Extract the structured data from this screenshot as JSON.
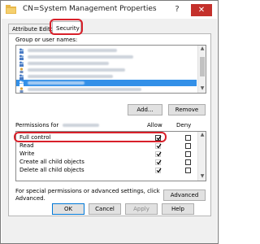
{
  "window": {
    "title": "CN=System Management Properties",
    "help_symbol": "?",
    "close_symbol": "✕"
  },
  "tabs": [
    {
      "label": "Attribute Editor",
      "active": false
    },
    {
      "label": "Security",
      "active": true
    }
  ],
  "security": {
    "group_label": "Group or user names:",
    "add_label": "Add...",
    "remove_label": "Remove",
    "permissions_label": "Permissions for",
    "allow_label": "Allow",
    "deny_label": "Deny",
    "permissions": [
      {
        "name": "Full control",
        "allow": true,
        "deny": false
      },
      {
        "name": "Read",
        "allow": true,
        "deny": false
      },
      {
        "name": "Write",
        "allow": true,
        "deny": false
      },
      {
        "name": "Create all child objects",
        "allow": true,
        "deny": false
      },
      {
        "name": "Delete all child objects",
        "allow": true,
        "deny": false
      }
    ],
    "special_text_1": "For special permissions or advanced settings, click",
    "special_text_2": "Advanced.",
    "advanced_label": "Advanced"
  },
  "footer": {
    "ok_label": "OK",
    "cancel_label": "Cancel",
    "apply_label": "Apply",
    "help_label": "Help"
  },
  "colors": {
    "highlight": "#d8202a",
    "selection": "#3390e8",
    "close": "#c4302b"
  }
}
